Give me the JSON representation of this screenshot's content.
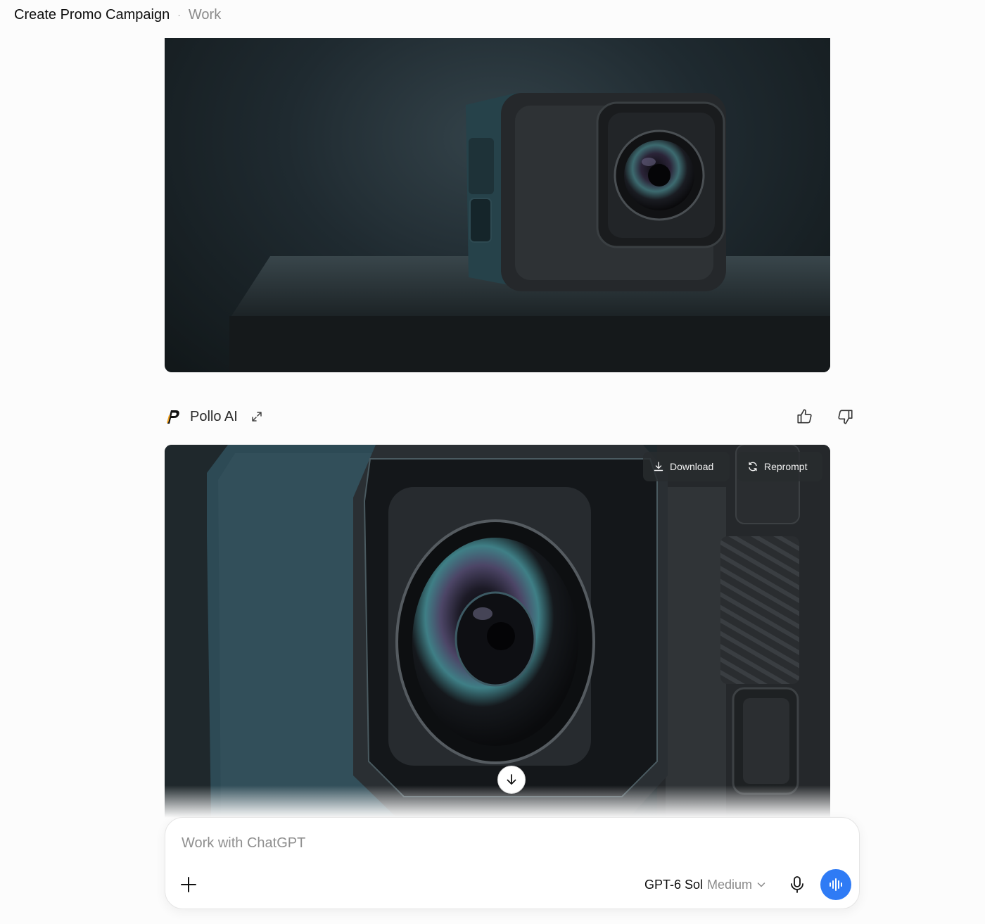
{
  "header": {
    "title": "Create Promo Campaign",
    "separator": "·",
    "context": "Work"
  },
  "images": [
    {
      "alt": "Action camera product shot on dark pedestal"
    },
    {
      "alt": "Close-up of action camera lens"
    }
  ],
  "message": {
    "source_name": "Pollo AI",
    "actions": {
      "download_label": "Download",
      "reprompt_label": "Reprompt"
    }
  },
  "composer": {
    "placeholder": "Work with ChatGPT",
    "model_name": "GPT-6 Sol",
    "model_effort": "Medium"
  },
  "colors": {
    "accent": "#2f7bf5",
    "background": "#fcfcfc"
  }
}
